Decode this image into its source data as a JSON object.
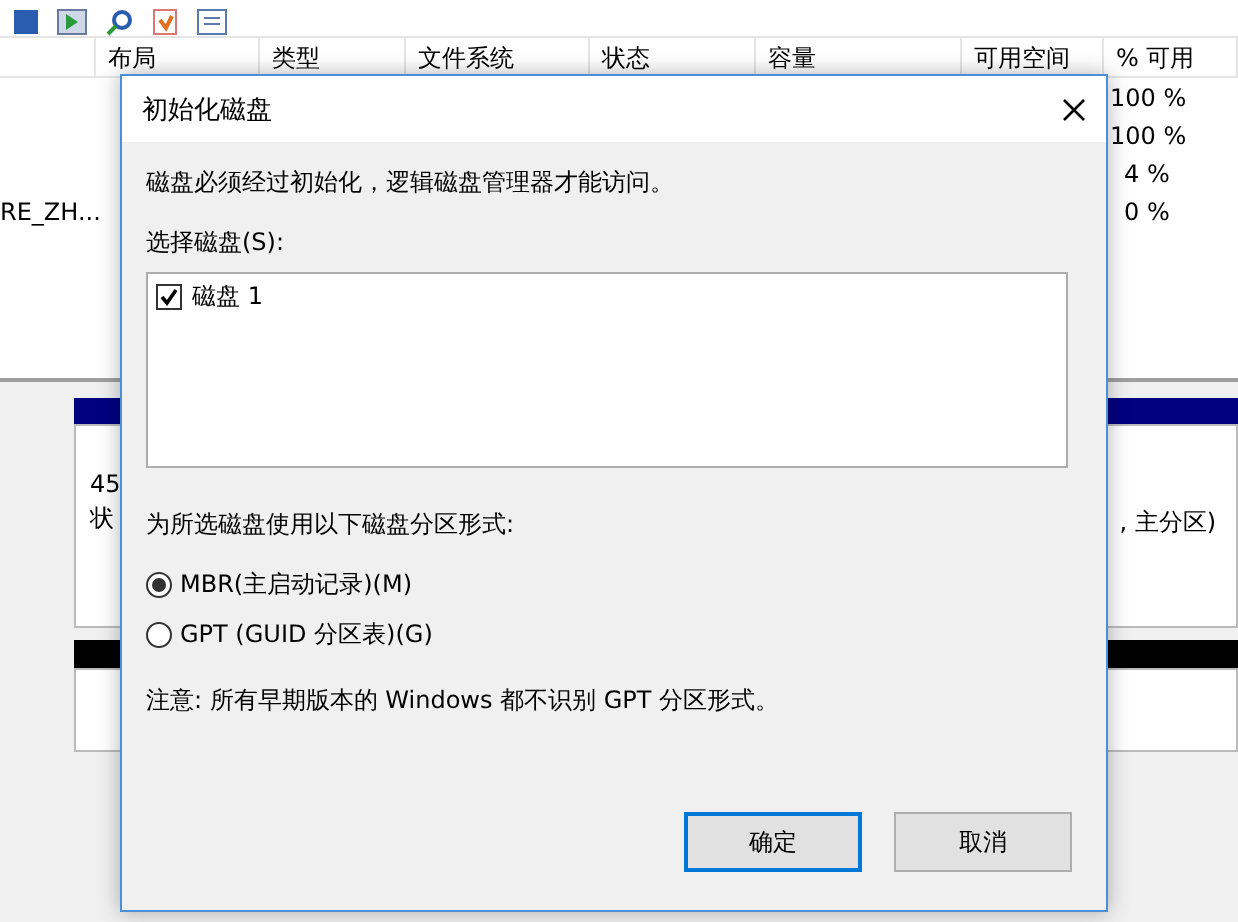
{
  "background": {
    "columns": [
      "布局",
      "类型",
      "文件系统",
      "状态",
      "容量",
      "可用空间",
      "% 可用"
    ],
    "rows": [
      {
        "percent_free": "100 %"
      },
      {
        "percent_free": "100 %"
      },
      {
        "percent_free": "4 %"
      },
      {
        "volume": "RE_ZH...",
        "percent_free": "0 %"
      }
    ],
    "disk_view": {
      "disk_size": "45",
      "disk_status": "状",
      "partition_info": ", 主分区)"
    }
  },
  "dialog": {
    "title": "初始化磁盘",
    "message": "磁盘必须经过初始化，逻辑磁盘管理器才能访问。",
    "disk_list_label": "选择磁盘(S):",
    "disks": [
      {
        "label": "磁盘 1",
        "checked": true
      }
    ],
    "style_label": "为所选磁盘使用以下磁盘分区形式:",
    "styles": [
      {
        "label": "MBR(主启动记录)(M)",
        "selected": true
      },
      {
        "label": "GPT (GUID 分区表)(G)",
        "selected": false
      }
    ],
    "note": "注意: 所有早期版本的 Windows 都不识别 GPT 分区形式。",
    "buttons": [
      {
        "label": "确定",
        "default": true
      },
      {
        "label": "取消",
        "default": false
      }
    ]
  }
}
